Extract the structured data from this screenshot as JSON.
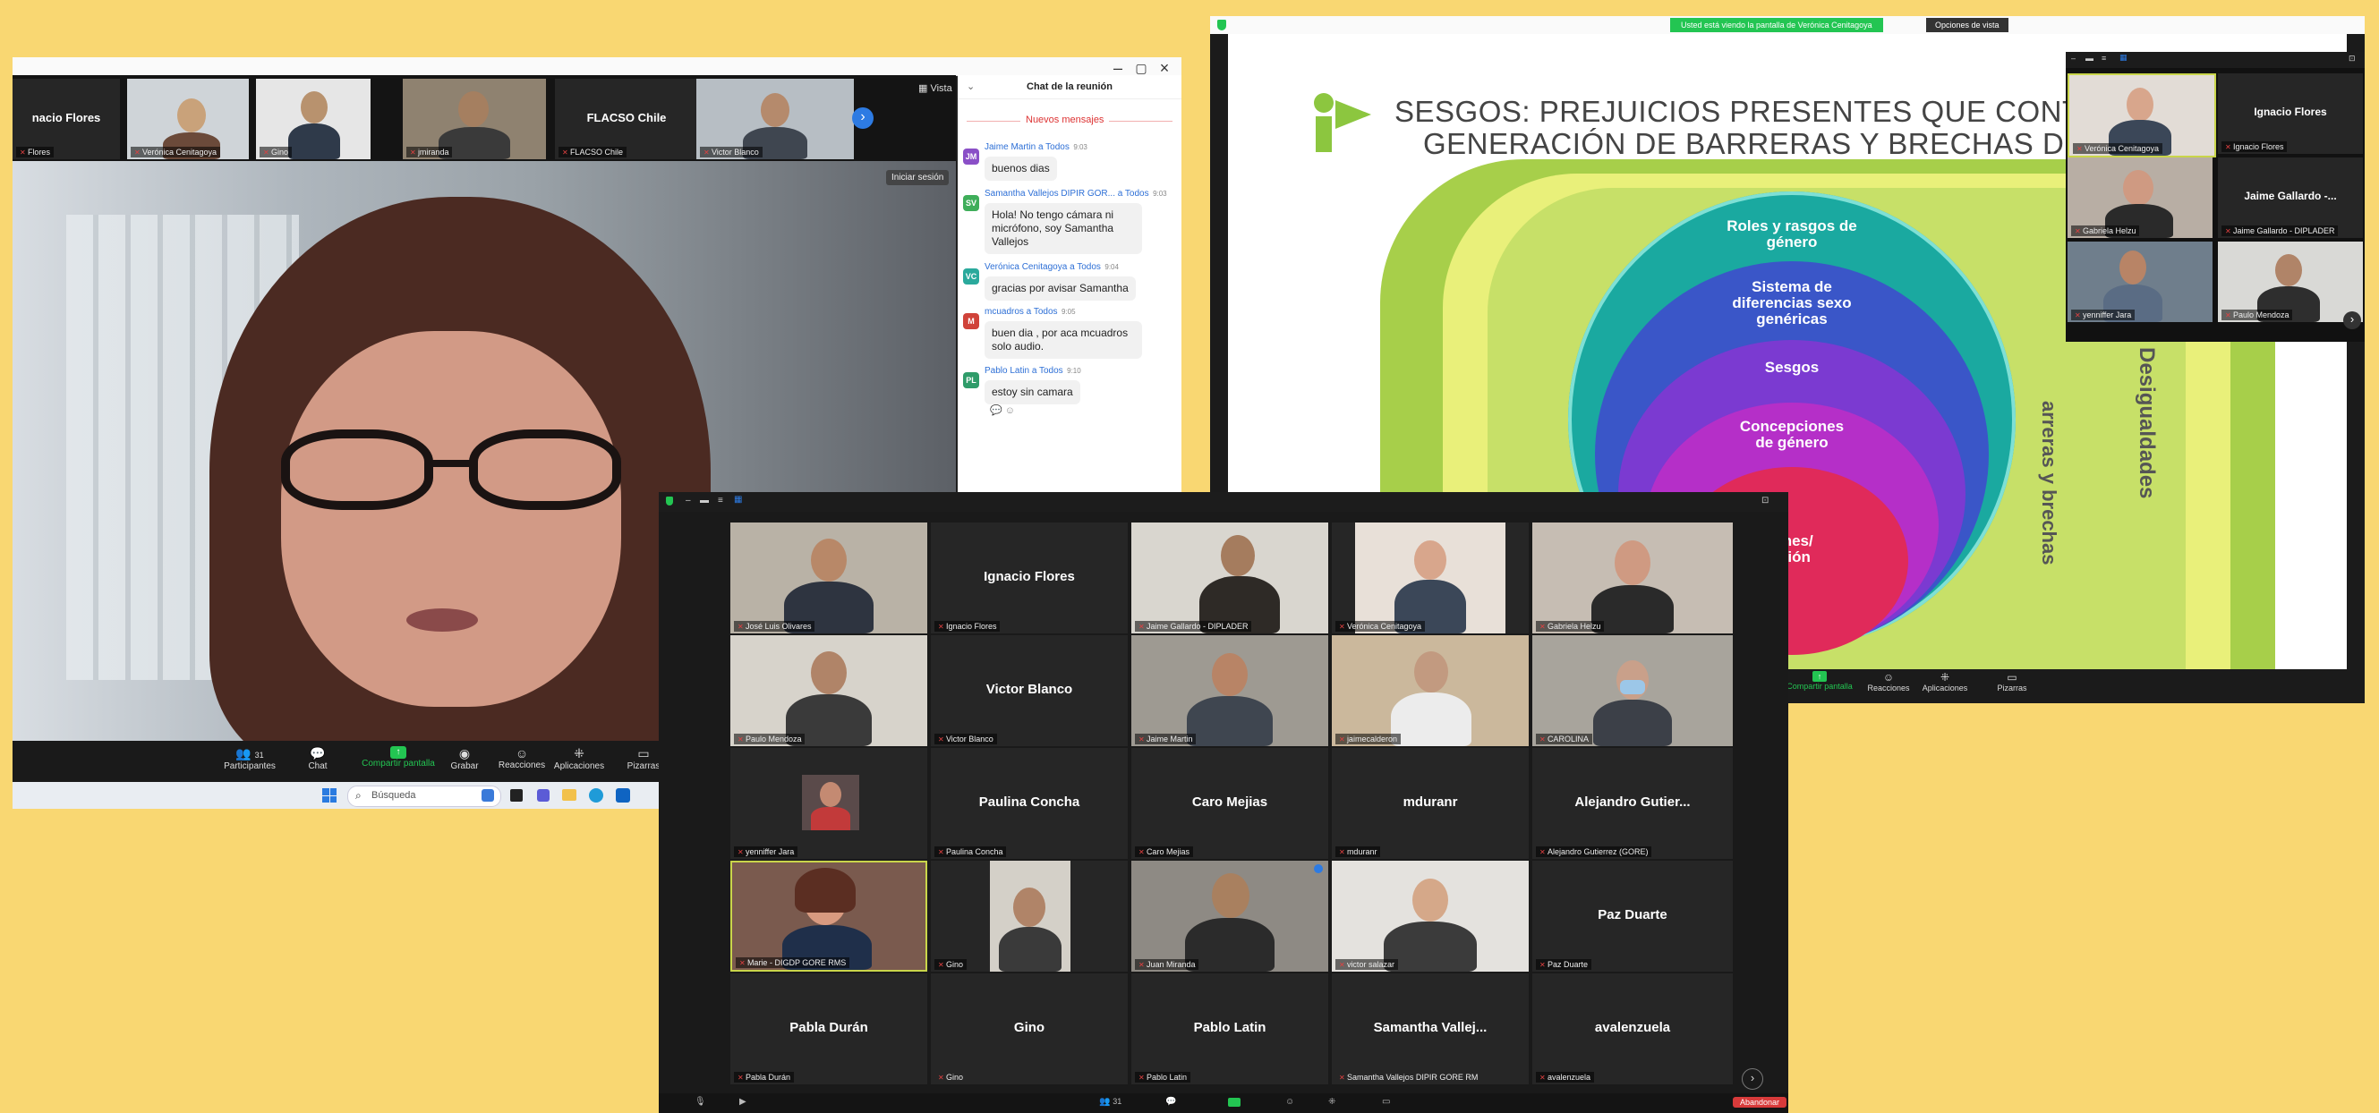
{
  "window1": {
    "top_strip": [
      {
        "name": "Ignacio Flores",
        "label": "Ignacio Flores",
        "type": "name",
        "display": "nacio Flores",
        "label_display": "Flores"
      },
      {
        "label": "Verónica Cenitagoya",
        "type": "video"
      },
      {
        "label": "Gino",
        "type": "video"
      },
      {
        "label": "jmiranda",
        "type": "video"
      },
      {
        "name": "FLACSO Chile",
        "label": "FLACSO Chile",
        "type": "name"
      },
      {
        "label": "Victor Blanco",
        "type": "video"
      }
    ],
    "view_label": "Vista",
    "signin_label": "Iniciar sesión",
    "toolbar": {
      "participants_label": "Participantes",
      "participants_count": "31",
      "chat_label": "Chat",
      "share_label": "Compartir pantalla",
      "record_label": "Grabar",
      "reactions_label": "Reacciones",
      "apps_label": "Aplicaciones",
      "whiteboard_label": "Pizarras"
    },
    "taskbar": {
      "search_placeholder": "Búsqueda"
    },
    "chat": {
      "title": "Chat de la reunión",
      "new_messages": "Nuevos mensajes",
      "messages": [
        {
          "initials": "JM",
          "color": "#8a4fc7",
          "sender": "Jaime Martin a Todos",
          "time": "9:03",
          "text": "buenos dias"
        },
        {
          "initials": "SV",
          "color": "#3fae5a",
          "sender": "Samantha Vallejos DIPIR GOR... a Todos",
          "time": "9:03",
          "text": "Hola! No tengo cámara ni micrófono, soy Samantha Vallejos"
        },
        {
          "initials": "VC",
          "color": "#2aa99c",
          "sender": "Verónica Cenitagoya a Todos",
          "time": "9:04",
          "text": "gracias por avisar Samantha"
        },
        {
          "initials": "M",
          "color": "#d0433a",
          "sender": "mcuadros a Todos",
          "time": "9:05",
          "text": "buen dia , por aca mcuadros solo audio."
        },
        {
          "initials": "PL",
          "color": "#2f9c6a",
          "sender": "Pablo Latin a Todos",
          "time": "9:10",
          "text": "estoy sin camara"
        }
      ]
    }
  },
  "window2": {
    "banner": "Usted está viendo la pantalla de Verónica Cenitagoya",
    "view_options": "Opciones de vista",
    "slide": {
      "title_line1": "SESGOS: PREJUICIOS PRESENTES QUE CONTRIBUY",
      "title_line2": "GENERACIÓN DE BARRERAS Y BRECHAS DE GÉ",
      "rings": [
        {
          "text": "Roles y rasgos de género",
          "color": "#1aa9a0"
        },
        {
          "text": "Sistema de diferencias sexo genéricas",
          "color": "#3a56c8"
        },
        {
          "text": "Sesgos",
          "color": "#7b3ad1"
        },
        {
          "text": "Concepciones de género",
          "color": "#b52fc8"
        },
        {
          "text": "acciones/ alización",
          "color": "#e02a5a"
        }
      ],
      "side_label1": "arreras y brechas",
      "side_label2": "Desigualdades"
    },
    "mini_gallery": [
      {
        "label": "Verónica Cenitagoya",
        "type": "video"
      },
      {
        "name": "Ignacio Flores",
        "label": "Ignacio Flores",
        "type": "name"
      },
      {
        "label": "Gabriela Helzu",
        "type": "video"
      },
      {
        "name": "Jaime Gallardo -...",
        "label": "Jaime Gallardo - DIPLADER",
        "type": "name"
      },
      {
        "label": "yenniffer Jara",
        "type": "video"
      },
      {
        "label": "Paulo Mendoza",
        "type": "video"
      }
    ],
    "toolbar": {
      "share_label": "Compartir pantalla",
      "reactions_label": "Reacciones",
      "apps_label": "Aplicaciones",
      "whiteboard_label": "Pizarras"
    }
  },
  "window3": {
    "tiles": [
      {
        "label": "José Luis Olivares",
        "type": "video"
      },
      {
        "name": "Ignacio Flores",
        "label": "Ignacio Flores",
        "type": "name"
      },
      {
        "label": "Jaime Gallardo - DIPLADER",
        "type": "video"
      },
      {
        "label": "Verónica Cenitagoya",
        "type": "video"
      },
      {
        "label": "Gabriela Helzu",
        "type": "video"
      },
      {
        "label": "Paulo Mendoza",
        "type": "video"
      },
      {
        "name": "Victor Blanco",
        "label": "Victor Blanco",
        "type": "name"
      },
      {
        "label": "Jaime Martin",
        "type": "video"
      },
      {
        "label": "jaimecalderon",
        "type": "video"
      },
      {
        "label": "CAROLINA",
        "type": "video"
      },
      {
        "label": "yenniffer Jara",
        "type": "small"
      },
      {
        "name": "Paulina Concha",
        "label": "Paulina Concha",
        "type": "name"
      },
      {
        "name": "Caro Mejias",
        "label": "Caro Mejias",
        "type": "name"
      },
      {
        "name": "mduranr",
        "label": "mduranr",
        "type": "name"
      },
      {
        "name": "Alejandro Gutier...",
        "label": "Alejandro Gutierrez (GORE)",
        "type": "name"
      },
      {
        "label": "Marie - DIGDP GORE RMS",
        "type": "video"
      },
      {
        "label": "Gino",
        "type": "video"
      },
      {
        "label": "Juan Miranda",
        "type": "video"
      },
      {
        "label": "victor salazar",
        "type": "video"
      },
      {
        "name": "Paz Duarte",
        "label": "Paz Duarte",
        "type": "name"
      },
      {
        "name": "Pabla Durán",
        "label": "Pabla Durán",
        "type": "name"
      },
      {
        "name": "Gino",
        "label": "Gino",
        "type": "name"
      },
      {
        "name": "Pablo Latin",
        "label": "Pablo Latin",
        "type": "name"
      },
      {
        "name": "Samantha Vallej...",
        "label": "Samantha Vallejos DIPIR GORE RM",
        "type": "name"
      },
      {
        "name": "avalenzuela",
        "label": "avalenzuela",
        "type": "name"
      }
    ],
    "participants_count": "31",
    "leave_label": "Abandonar"
  },
  "colors": {
    "accent_green": "#23c552",
    "link_blue": "#2d6fd6",
    "page_bg": "#f9d772"
  }
}
